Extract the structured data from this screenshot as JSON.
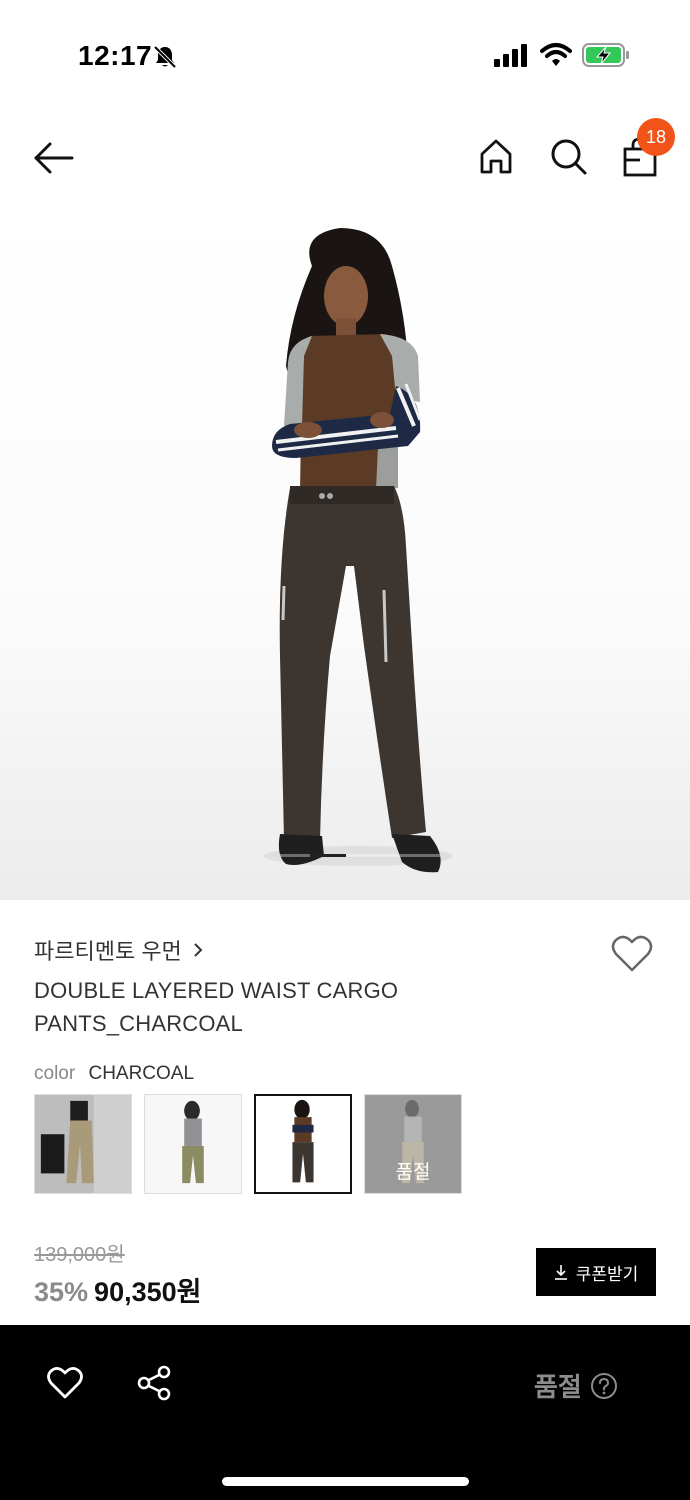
{
  "status_bar": {
    "time": "12:17",
    "icons": [
      "bell-slash-icon",
      "signal-icon",
      "wifi-icon",
      "battery-charging-icon"
    ]
  },
  "nav": {
    "icons": [
      "back-arrow-icon",
      "home-icon",
      "search-icon",
      "shopping-bag-icon"
    ],
    "cart_count": "18",
    "badge_color": "#f25319"
  },
  "hero": {
    "carousel_current": 1
  },
  "product": {
    "brand": "파르티멘토 우먼",
    "title_line1": "DOUBLE LAYERED WAIST CARGO",
    "title_line2": "PANTS_CHARCOAL",
    "color_label": "color",
    "color_value": "CHARCOAL",
    "swatches": [
      {
        "name": "beige",
        "selected": false,
        "sold_out": false
      },
      {
        "name": "khaki",
        "selected": false,
        "sold_out": false
      },
      {
        "name": "charcoal",
        "selected": true,
        "sold_out": false
      },
      {
        "name": "light-beige",
        "selected": false,
        "sold_out": true,
        "badge": "품절"
      }
    ]
  },
  "pricing": {
    "original_price": "139,000원",
    "discount": "35%",
    "sale_price": "90,350원",
    "coupon_button": "쿠폰받기"
  },
  "bottom_bar": {
    "status_text": "품절",
    "icons": [
      "heart-icon",
      "share-icon",
      "help-circle-icon"
    ]
  }
}
